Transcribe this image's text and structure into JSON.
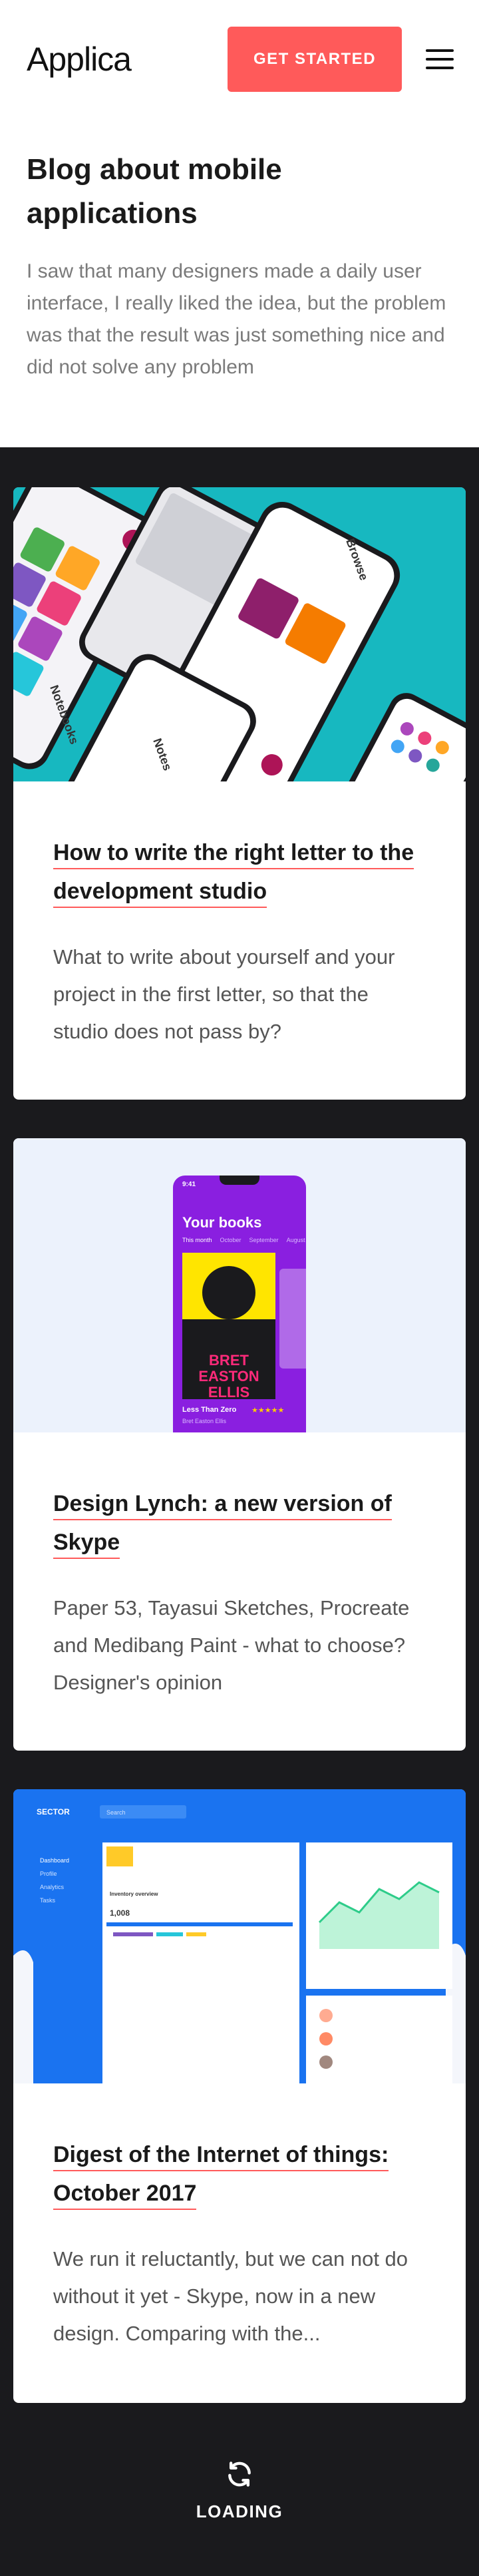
{
  "header": {
    "logo": "Applica",
    "cta_label": "GET STARTED"
  },
  "hero": {
    "title": "Blog about mobile applications",
    "description": "I saw that many designers made a daily user interface, I really liked the idea, but the problem was that the result was just something nice and did not solve any problem"
  },
  "posts": [
    {
      "title": "How to write the right letter to the development studio",
      "excerpt": "What to write about yourself and your project in the first letter, so that the studio does not pass by?",
      "image": {
        "notebooks_label": "Notebooks",
        "notes_label": "Notes",
        "browse_label": "Browse"
      }
    },
    {
      "title": "Design Lynch: a new version of Skype",
      "excerpt": "Paper 53, Tayasui Sketches, Procreate and Medibang Paint - what to choose? Designer's opinion",
      "image": {
        "time": "9:41",
        "heading": "Your books",
        "tabs": [
          "This month",
          "October",
          "September",
          "August"
        ],
        "book_cover_text": "BRET EASTON ELLIS",
        "book_title": "Less Than Zero",
        "book_author": "Bret Easton Ellis",
        "rating": "★★★★★"
      }
    },
    {
      "title": "Digest of the Internet of things: October 2017",
      "excerpt": "We run it reluctantly, but we can not do without it yet - Skype, now in a new design. Comparing with the...",
      "image": {
        "brand": "SECTOR",
        "search_placeholder": "Search",
        "nav_items": [
          "Dashboard",
          "Profile",
          "Analytics",
          "Tasks"
        ],
        "stat_value": "1,008",
        "stat_label": "Inventory overview"
      }
    }
  ],
  "loading": {
    "icon": "refresh-icon",
    "label": "LOADING"
  },
  "colors": {
    "accent": "#ff5a5a",
    "dark_bg": "#1a1a1d",
    "teal": "#17b8c0",
    "purple": "#8a1fe0",
    "blue": "#1a73f0"
  }
}
